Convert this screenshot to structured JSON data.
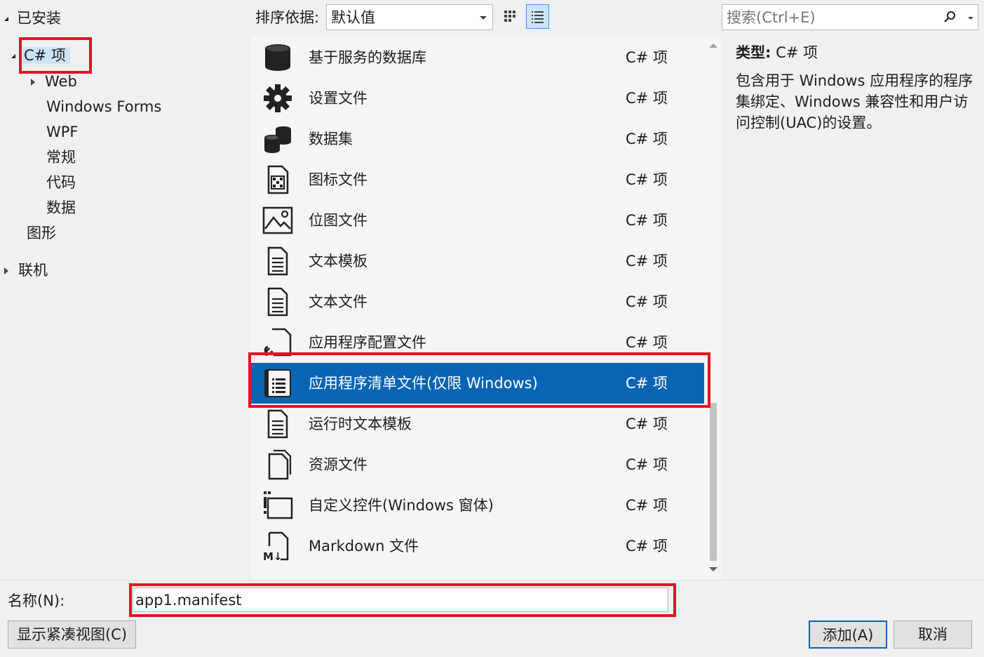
{
  "tree": {
    "installed": "已安装",
    "csharp_items": "C# 项",
    "children": [
      "Web",
      "Windows Forms",
      "WPF",
      "常规",
      "代码",
      "数据"
    ],
    "graphics": "图形",
    "online": "联机"
  },
  "toolbar": {
    "sort_label": "排序依据:",
    "sort_value": "默认值",
    "search_placeholder": "搜索(Ctrl+E)"
  },
  "list": {
    "items": [
      {
        "name": "基于服务的数据库",
        "type": "C# 项",
        "icon": "database-icon"
      },
      {
        "name": "设置文件",
        "type": "C# 项",
        "icon": "gear-icon"
      },
      {
        "name": "数据集",
        "type": "C# 项",
        "icon": "dataset-icon"
      },
      {
        "name": "图标文件",
        "type": "C# 项",
        "icon": "icon-file-icon"
      },
      {
        "name": "位图文件",
        "type": "C# 项",
        "icon": "bitmap-icon"
      },
      {
        "name": "文本模板",
        "type": "C# 项",
        "icon": "text-template-icon"
      },
      {
        "name": "文本文件",
        "type": "C# 项",
        "icon": "text-file-icon"
      },
      {
        "name": "应用程序配置文件",
        "type": "C# 项",
        "icon": "config-file-icon"
      },
      {
        "name": "应用程序清单文件(仅限 Windows)",
        "type": "C# 项",
        "icon": "manifest-icon",
        "selected": true
      },
      {
        "name": "运行时文本模板",
        "type": "C# 项",
        "icon": "runtime-template-icon"
      },
      {
        "name": "资源文件",
        "type": "C# 项",
        "icon": "resource-file-icon"
      },
      {
        "name": "自定义控件(Windows 窗体)",
        "type": "C# 项",
        "icon": "custom-control-icon"
      },
      {
        "name": "Markdown 文件",
        "type": "C# 项",
        "icon": "markdown-icon"
      }
    ]
  },
  "details": {
    "type_label": "类型:",
    "type_value": "C# 项",
    "description": "包含用于 Windows 应用程序的程序集绑定、Windows 兼容性和用户访问控制(UAC)的设置。"
  },
  "bottom": {
    "name_label": "名称(N):",
    "name_value": "app1.manifest",
    "compact_view_button": "显示紧凑视图(C)",
    "add_button": "添加(A)",
    "cancel_button": "取消"
  },
  "colors": {
    "selection": "#0a64b4",
    "highlight_box": "#e81123",
    "tree_selection": "#cce4f7"
  }
}
